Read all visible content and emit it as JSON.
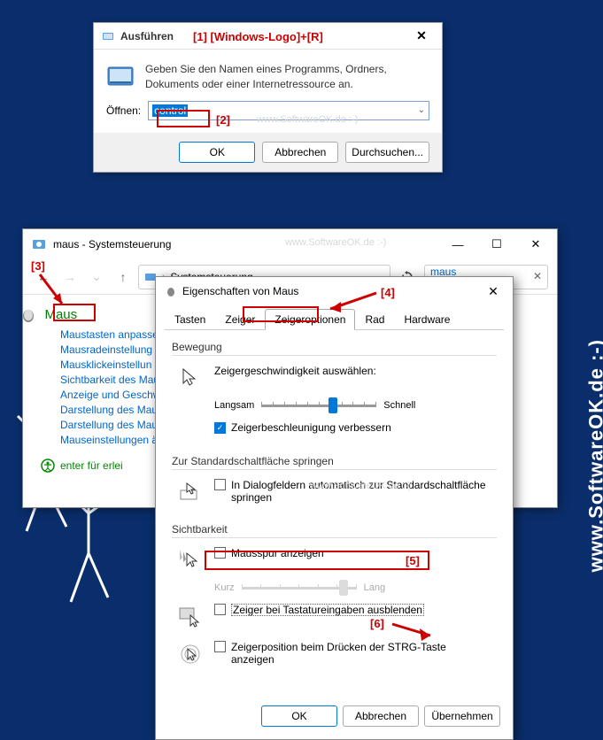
{
  "watermark_side": "www.SoftwareOK.de :-)",
  "watermark_inner": "www.SoftwareOK.de :-)",
  "annotations": {
    "a1": "[1] [Windows-Logo]+[R]",
    "a2": "[2]",
    "a3": "[3]",
    "a4": "[4]",
    "a5": "[5]",
    "a6": "[6]"
  },
  "run": {
    "title": "Ausführen",
    "description": "Geben Sie den Namen eines Programms, Ordners, Dokuments oder einer Internetressource an.",
    "open_label": "Öffnen:",
    "input_value": "control",
    "ok": "OK",
    "cancel": "Abbrechen",
    "browse": "Durchsuchen..."
  },
  "cp": {
    "title": "maus - Systemsteuerung",
    "breadcrumb": "Systemsteuerung",
    "search_value": "maus",
    "category": "Maus",
    "links": [
      "Maustasten anpasse",
      "Mausradeinstellung",
      "Mausklickeinstellun",
      "Sichtbarkeit des Mau",
      "Anzeige und Geschw",
      "Darstellung des Mau",
      "Darstellung des Mau",
      "Mauseinstellungen ä"
    ],
    "footer": "enter für erlei"
  },
  "mouse": {
    "title": "Eigenschaften von Maus",
    "tabs": [
      "Tasten",
      "Zeiger",
      "Zeigeroptionen",
      "Rad",
      "Hardware"
    ],
    "group_movement": "Bewegung",
    "speed_label": "Zeigergeschwindigkeit auswählen:",
    "slow": "Langsam",
    "fast": "Schnell",
    "enhance": "Zeigerbeschleunigung verbessern",
    "group_snap": "Zur Standardschaltfläche springen",
    "snap_text": "In Dialogfeldern automatisch zur Standardschaltfläche springen",
    "group_visibility": "Sichtbarkeit",
    "trails": "Mausspur anzeigen",
    "short": "Kurz",
    "long": "Lang",
    "hide_typing": "Zeiger bei Tastatureingaben ausblenden",
    "ctrl_locate": "Zeigerposition beim Drücken der STRG-Taste anzeigen",
    "ok": "OK",
    "cancel": "Abbrechen",
    "apply": "Übernehmen"
  }
}
